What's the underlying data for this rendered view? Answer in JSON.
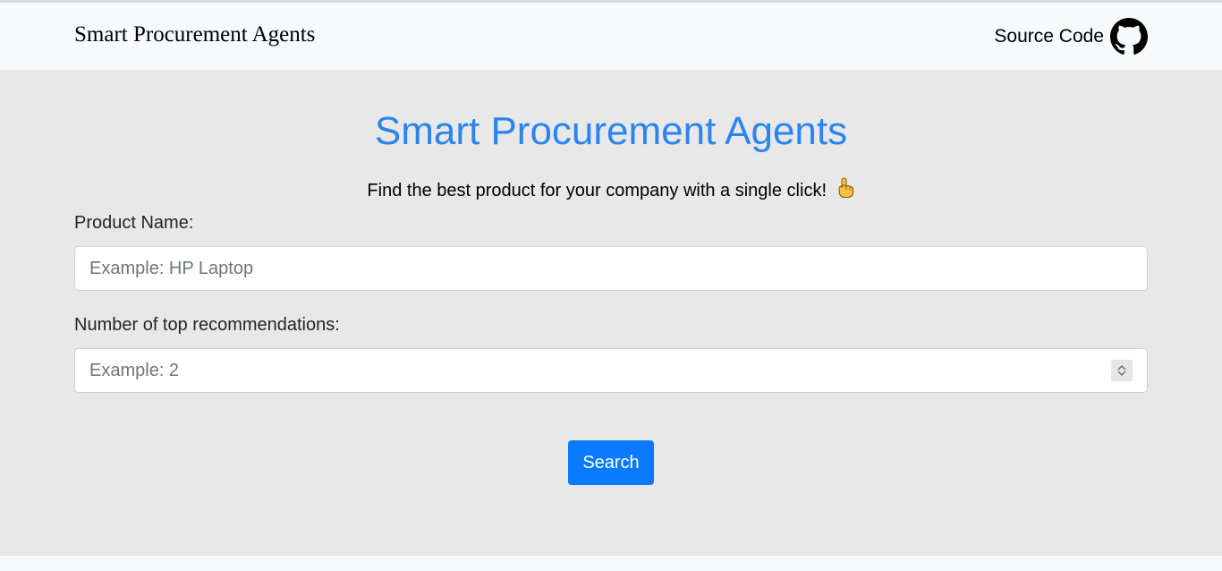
{
  "navbar": {
    "brand": "Smart Procurement Agents",
    "source_label": "Source Code",
    "source_icon": "github-icon"
  },
  "main": {
    "title": "Smart Procurement Agents",
    "tagline": "Find the best product for your company with a single click!",
    "tagline_icon": "pointing-hand-icon"
  },
  "form": {
    "product_label": "Product Name:",
    "product_placeholder": "Example: HP Laptop",
    "product_value": "",
    "count_label": "Number of top recommendations:",
    "count_placeholder": "Example: 2",
    "count_value": "",
    "search_label": "Search"
  },
  "colors": {
    "accent": "#2a85ee",
    "button": "#0a7bff",
    "main_background": "#e8e8e8",
    "navbar_background": "#f8f9fa"
  }
}
